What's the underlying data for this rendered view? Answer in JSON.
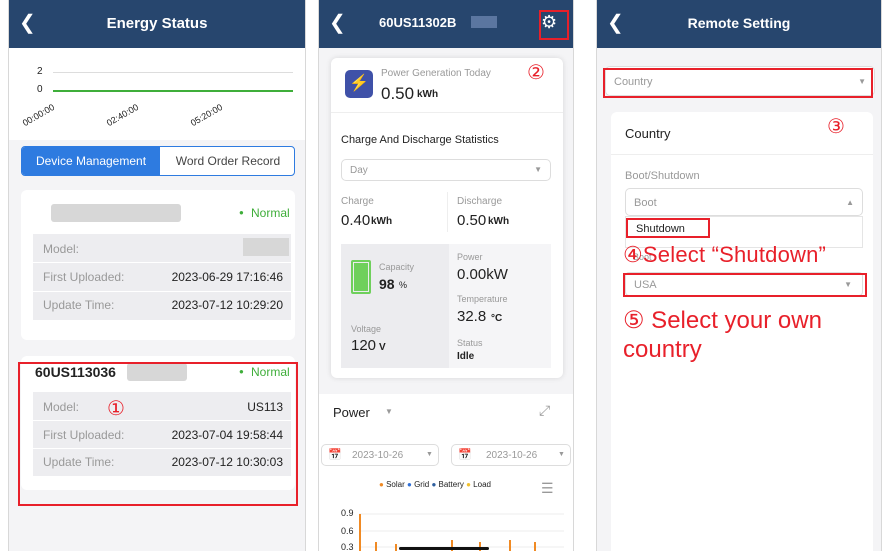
{
  "p1": {
    "title": "Energy Status",
    "chart": {
      "y_ticks": [
        "2",
        "0"
      ],
      "x_ticks": [
        "00:00:00",
        "02:40:00",
        "05:20:00"
      ]
    },
    "tabs": [
      "Device Management",
      "Word Order Record"
    ],
    "device1": {
      "status": "Normal",
      "rows": [
        {
          "label": "Model:",
          "value": ""
        },
        {
          "label": "First Uploaded:",
          "value": "2023-06-29 17:16:46"
        },
        {
          "label": "Update Time:",
          "value": "2023-07-12 10:29:20"
        }
      ]
    },
    "device2": {
      "name": "60US113036",
      "status": "Normal",
      "rows": [
        {
          "label": "Model:",
          "value": "US113"
        },
        {
          "label": "First Uploaded:",
          "value": "2023-07-04 19:58:44"
        },
        {
          "label": "Update Time:",
          "value": "2023-07-12 10:30:03"
        }
      ]
    },
    "marker": "①"
  },
  "p2": {
    "title": "60US11302B",
    "gen": {
      "label": "Power Generation Today",
      "value": "0.50",
      "unit": "kWh"
    },
    "marker": "②",
    "stats_title": "Charge And Discharge Statistics",
    "period": "Day",
    "charge": {
      "label": "Charge",
      "value": "0.40",
      "unit": "kWh"
    },
    "discharge": {
      "label": "Discharge",
      "value": "0.50",
      "unit": "kWh"
    },
    "capacity": {
      "label": "Capacity",
      "value": "98",
      "unit": "%"
    },
    "power": {
      "label": "Power",
      "value": "0.00kW"
    },
    "temperature": {
      "label": "Temperature",
      "value": "32.8",
      "unit": "°C"
    },
    "voltage": {
      "label": "Voltage",
      "value": "120",
      "unit": "V"
    },
    "status": {
      "label": "Status",
      "value": "Idle"
    },
    "power_select": "Power",
    "date1": "2023-10-26",
    "date2": "2023-10-26",
    "legend": [
      {
        "name": "Solar",
        "color": "#f08a24"
      },
      {
        "name": "Grid",
        "color": "#2f6fd6"
      },
      {
        "name": "Battery",
        "color": "#2f5f9e"
      },
      {
        "name": "Load",
        "color": "#f2c12e"
      }
    ],
    "y_ticks": [
      "0.9",
      "0.6",
      "0.3"
    ]
  },
  "p3": {
    "title": "Remote Setting",
    "country_select": "Country",
    "marker3": "③",
    "country_title": "Country",
    "boot_label": "Boot/Shutdown",
    "boot_value": "Boot",
    "option": "Shutdown",
    "behind": "Boot",
    "step4": "④Select “Shutdown”",
    "usa": "USA",
    "step5": "⑤ Select your own country"
  }
}
